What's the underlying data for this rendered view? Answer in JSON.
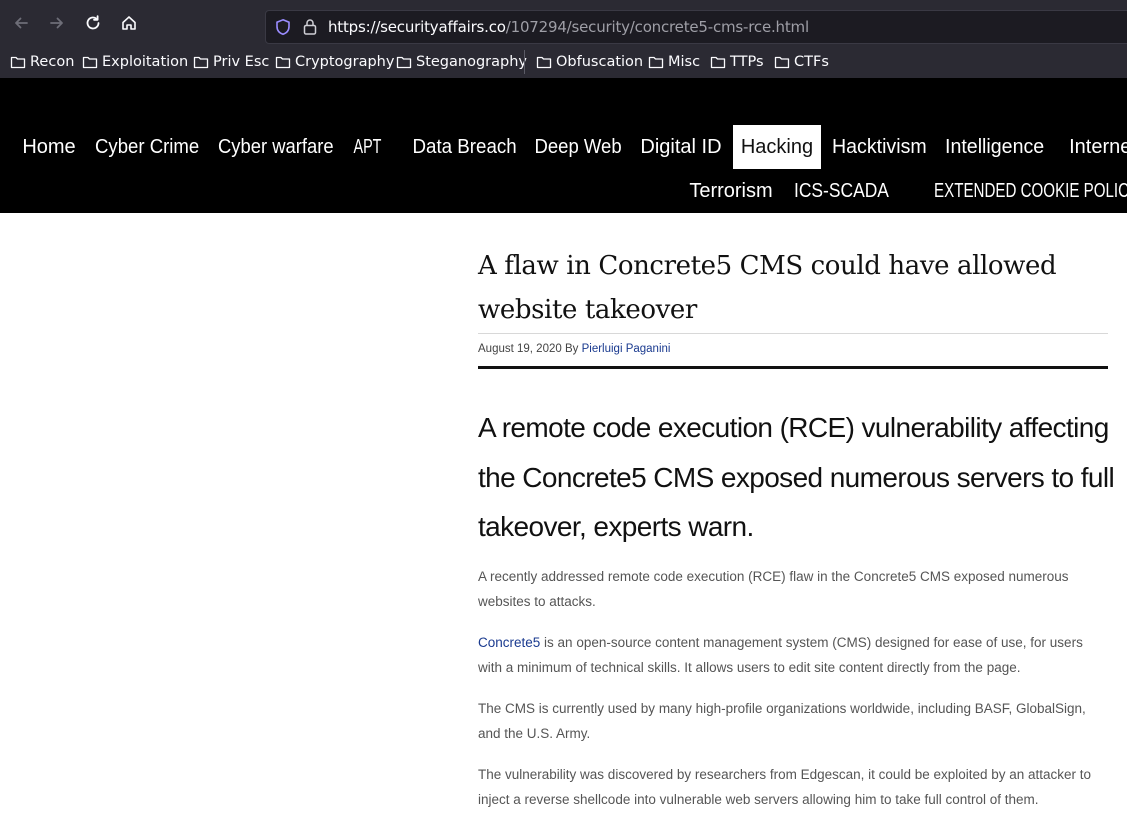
{
  "browser": {
    "url_domain": "https://securityaffairs.co",
    "url_path": "/107294/security/concrete5-cms-rce.html",
    "bookmarks": [
      "Recon",
      "Exploitation",
      "Priv Esc",
      "Cryptography",
      "Steganography",
      "Obfuscation",
      "Misc",
      "TTPs",
      "CTFs"
    ]
  },
  "site_nav": {
    "row1": [
      "Home",
      "Cyber Crime",
      "Cyber warfare",
      "APT",
      "Data Breach",
      "Deep Web",
      "Digital ID",
      "Hacking",
      "Hacktivism",
      "Intelligence",
      "Internet"
    ],
    "row2": [
      "Terrorism",
      "ICS-SCADA",
      "EXTENDED COOKIE POLICY"
    ],
    "active": "Hacking"
  },
  "article": {
    "title": "A flaw in Concrete5 CMS could have allowed website takeover",
    "date": "August 19, 2020",
    "by": "By",
    "author": "Pierluigi Paganini",
    "lead": "A remote code execution (RCE) vulnerability affecting the Concrete5 CMS exposed numerous servers to full takeover, experts warn.",
    "p1": "A recently addressed remote code execution (RCE) flaw in the Concrete5 CMS exposed numerous websites to attacks.",
    "p2_link": "Concrete5",
    "p2_rest": " is an open-source content management system (CMS) designed for ease of use, for users with a minimum of technical skills. It allows users to edit site content directly from the page.",
    "p3": "The CMS is currently used by many high-profile organizations worldwide, including BASF, GlobalSign, and the U.S. Army.",
    "p4": "The vulnerability was discovered by researchers from Edgescan, it could be exploited by an attacker to inject a reverse shellcode into vulnerable web servers allowing him to take full control of them."
  },
  "colors": {
    "chrome_bg": "#2b2a33",
    "urlbar_bg": "#1c1b22",
    "nav_bg": "#000000",
    "link": "#1a3a8f"
  }
}
